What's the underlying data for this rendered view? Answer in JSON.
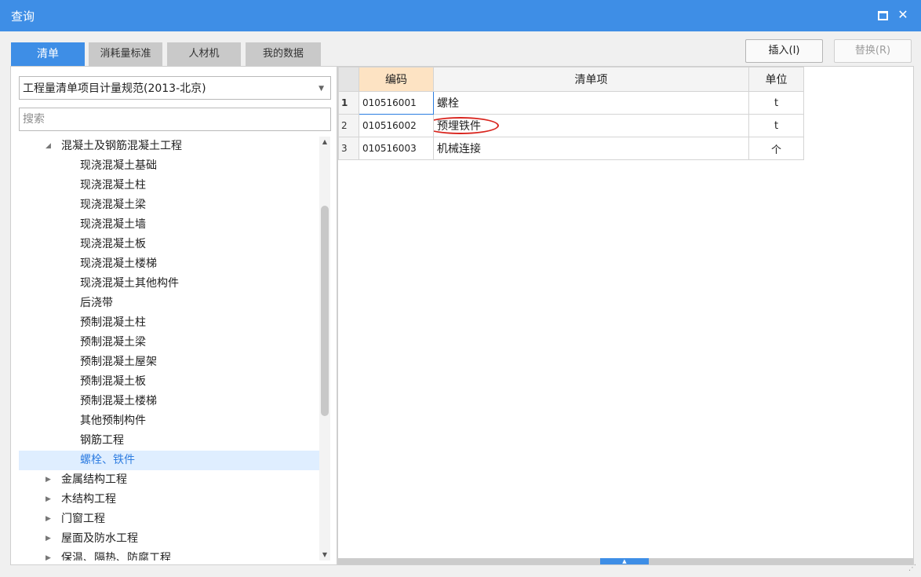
{
  "window": {
    "title": "查询"
  },
  "tabs": [
    {
      "label": "清单",
      "active": true
    },
    {
      "label": "消耗量标准",
      "active": false
    },
    {
      "label": "人材机",
      "active": false
    },
    {
      "label": "我的数据",
      "active": false
    }
  ],
  "buttons": {
    "insert": "插入(I)",
    "replace": "替换(R)"
  },
  "left": {
    "standard_selected": "工程量清单项目计量规范(2013-北京)",
    "search_placeholder": "搜索",
    "tree": [
      {
        "label": "混凝土及钢筋混凝土工程",
        "level": 1,
        "expanded": true
      },
      {
        "label": "现浇混凝土基础",
        "level": 2
      },
      {
        "label": "现浇混凝土柱",
        "level": 2
      },
      {
        "label": "现浇混凝土梁",
        "level": 2
      },
      {
        "label": "现浇混凝土墙",
        "level": 2
      },
      {
        "label": "现浇混凝土板",
        "level": 2
      },
      {
        "label": "现浇混凝土楼梯",
        "level": 2
      },
      {
        "label": "现浇混凝土其他构件",
        "level": 2
      },
      {
        "label": "后浇带",
        "level": 2
      },
      {
        "label": "预制混凝土柱",
        "level": 2
      },
      {
        "label": "预制混凝土梁",
        "level": 2
      },
      {
        "label": "预制混凝土屋架",
        "level": 2
      },
      {
        "label": "预制混凝土板",
        "level": 2
      },
      {
        "label": "预制混凝土楼梯",
        "level": 2
      },
      {
        "label": "其他预制构件",
        "level": 2
      },
      {
        "label": "钢筋工程",
        "level": 2
      },
      {
        "label": "螺栓、铁件",
        "level": 2,
        "selected": true
      },
      {
        "label": "金属结构工程",
        "level": 1,
        "expanded": false
      },
      {
        "label": "木结构工程",
        "level": 1,
        "expanded": false
      },
      {
        "label": "门窗工程",
        "level": 1,
        "expanded": false
      },
      {
        "label": "屋面及防水工程",
        "level": 1,
        "expanded": false
      },
      {
        "label": "保温、隔热、防腐工程",
        "level": 1,
        "expanded": false
      }
    ]
  },
  "grid": {
    "columns": {
      "code": "编码",
      "item": "清单项",
      "unit": "单位"
    },
    "rows": [
      {
        "num": "1",
        "code": "010516001",
        "name": "螺栓",
        "unit": "t"
      },
      {
        "num": "2",
        "code": "010516002",
        "name": "预埋铁件",
        "unit": "t"
      },
      {
        "num": "3",
        "code": "010516003",
        "name": "机械连接",
        "unit": "个"
      }
    ]
  },
  "colors": {
    "accent": "#3e8ee6",
    "selected_bg": "#dfeeff",
    "code_header_bg": "#fde3c3",
    "annotation": "#d9251e"
  }
}
